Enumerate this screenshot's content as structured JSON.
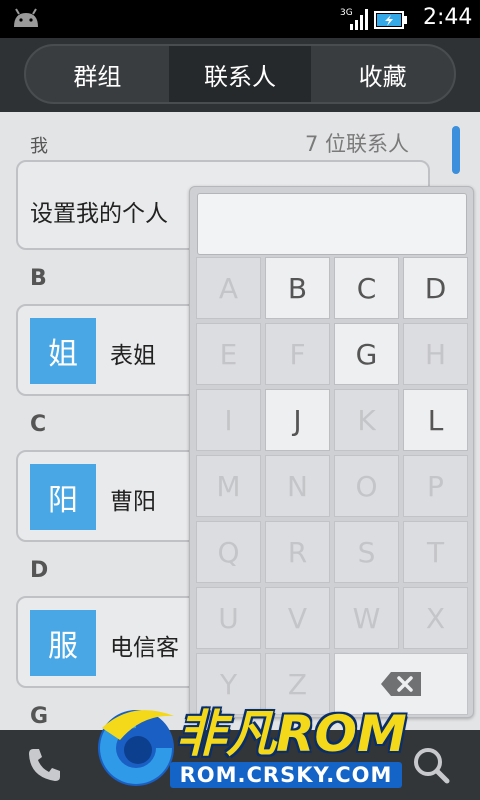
{
  "status_bar": {
    "network": "3G",
    "time": "2:44"
  },
  "tabs": [
    {
      "label": "群组",
      "active": false
    },
    {
      "label": "联系人",
      "active": true
    },
    {
      "label": "收藏",
      "active": false
    }
  ],
  "contacts": {
    "me_label": "我",
    "count_text": "7 位联系人",
    "me_setup_text": "设置我的个人",
    "groups": [
      {
        "letter": "B",
        "avatar_char": "姐",
        "name": "表姐"
      },
      {
        "letter": "C",
        "avatar_char": "阳",
        "name": "曹阳"
      },
      {
        "letter": "D",
        "avatar_char": "服",
        "name": "电信客"
      },
      {
        "letter": "G"
      }
    ]
  },
  "alpha_index": {
    "keys": [
      {
        "label": "A",
        "enabled": false
      },
      {
        "label": "B",
        "enabled": true
      },
      {
        "label": "C",
        "enabled": true
      },
      {
        "label": "D",
        "enabled": true
      },
      {
        "label": "E",
        "enabled": false
      },
      {
        "label": "F",
        "enabled": false
      },
      {
        "label": "G",
        "enabled": true
      },
      {
        "label": "H",
        "enabled": false
      },
      {
        "label": "I",
        "enabled": false
      },
      {
        "label": "J",
        "enabled": true
      },
      {
        "label": "K",
        "enabled": false
      },
      {
        "label": "L",
        "enabled": true
      },
      {
        "label": "M",
        "enabled": false
      },
      {
        "label": "N",
        "enabled": false
      },
      {
        "label": "O",
        "enabled": false
      },
      {
        "label": "P",
        "enabled": false
      },
      {
        "label": "Q",
        "enabled": false
      },
      {
        "label": "R",
        "enabled": false
      },
      {
        "label": "S",
        "enabled": false
      },
      {
        "label": "T",
        "enabled": false
      },
      {
        "label": "U",
        "enabled": false
      },
      {
        "label": "V",
        "enabled": false
      },
      {
        "label": "W",
        "enabled": false
      },
      {
        "label": "X",
        "enabled": false
      },
      {
        "label": "Y",
        "enabled": false
      },
      {
        "label": "Z",
        "enabled": false
      }
    ]
  },
  "bottom_bar": {
    "left_icon": "phone-icon",
    "right_icon": "search-icon"
  },
  "watermark": {
    "brand": "非凡ROM",
    "url": "ROM.CRSKY.COM"
  },
  "colors": {
    "accent": "#4aa7e6",
    "scroll": "#3c8fdc",
    "watermark_yellow": "#f4d81a",
    "watermark_blue": "#1464c8"
  }
}
